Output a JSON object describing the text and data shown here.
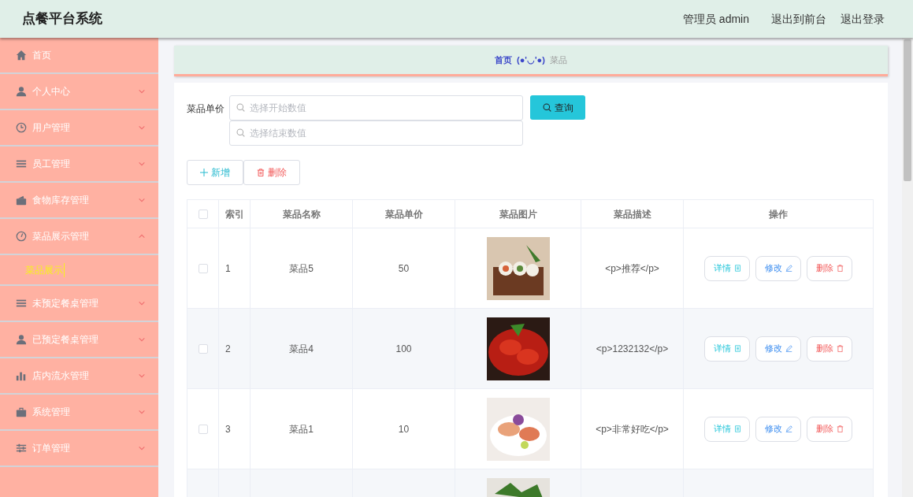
{
  "header": {
    "title": "点餐平台系统",
    "user": "管理员 admin",
    "links": [
      "退出到前台",
      "退出登录"
    ]
  },
  "sidebar": {
    "items": [
      {
        "label": "首页",
        "kind": "link"
      },
      {
        "label": "个人中心",
        "kind": "menu",
        "expanded": false
      },
      {
        "label": "用户管理",
        "kind": "menu",
        "expanded": false
      },
      {
        "label": "员工管理",
        "kind": "menu",
        "expanded": false
      },
      {
        "label": "食物库存管理",
        "kind": "menu",
        "expanded": false
      },
      {
        "label": "菜品展示管理",
        "kind": "menu",
        "expanded": true,
        "children": [
          {
            "label": "菜品展示",
            "selected": true
          }
        ]
      },
      {
        "label": "未预定餐桌管理",
        "kind": "menu",
        "expanded": false
      },
      {
        "label": "已预定餐桌管理",
        "kind": "menu",
        "expanded": false
      },
      {
        "label": "店内流水管理",
        "kind": "menu",
        "expanded": false
      },
      {
        "label": "系统管理",
        "kind": "menu",
        "expanded": false
      },
      {
        "label": "订单管理",
        "kind": "menu",
        "expanded": false
      }
    ]
  },
  "breadcrumb": {
    "home": "首页",
    "separator": "(●'◡'●)",
    "current": "菜品"
  },
  "filter": {
    "label": "菜品单价",
    "start_placeholder": "选择开始数值",
    "end_placeholder": "选择结束数值",
    "search_button": "查询"
  },
  "actions": {
    "add": "新增",
    "delete": "删除"
  },
  "table": {
    "columns": [
      "索引",
      "菜品名称",
      "菜品单价",
      "菜品图片",
      "菜品描述",
      "操作"
    ],
    "select_all_checked": false,
    "rows": [
      {
        "checked": false,
        "index": "1",
        "name": "菜品5",
        "price": "50",
        "description": "<p>推荐</p>",
        "picture": {
          "kind": "picture"
        },
        "buttons": [
          "详情",
          "修改",
          "删除"
        ]
      },
      {
        "checked": false,
        "index": "2",
        "name": "菜品4",
        "price": "100",
        "description": "<p>1232132</p>",
        "picture": {
          "kind": "picture"
        },
        "buttons": [
          "详情",
          "修改",
          "删除"
        ]
      },
      {
        "checked": false,
        "index": "3",
        "name": "菜品1",
        "price": "10",
        "description": "<p>非常好吃</p>",
        "picture": {
          "kind": "picture"
        },
        "buttons": [
          "详情",
          "修改",
          "删除"
        ]
      },
      {
        "picture": {
          "kind": "picture"
        }
      }
    ]
  }
}
